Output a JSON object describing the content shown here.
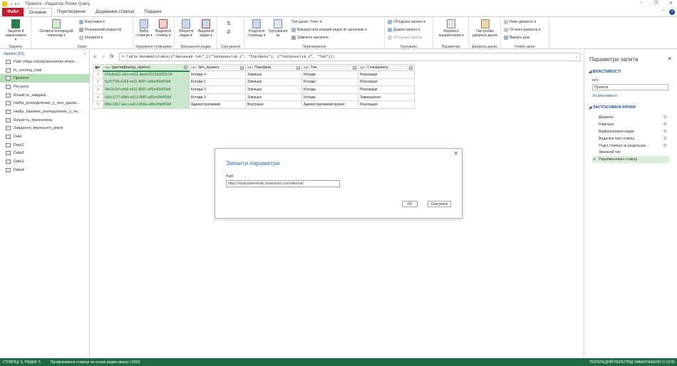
{
  "window": {
    "title": "Проекти - Редактор Power Query",
    "quick_access": "☺ ▾  ≡",
    "min": "–",
    "restore": "❐",
    "close": "✕"
  },
  "tabs": [
    {
      "label": "Файл"
    },
    {
      "label": "Основне"
    },
    {
      "label": "Перетворення"
    },
    {
      "label": "Додавання стовпця"
    },
    {
      "label": "Подання"
    }
  ],
  "ribbon": {
    "close": {
      "label": "Закрити й\nзавантажити ▾",
      "group": "Закрити"
    },
    "query": {
      "refresh": "Оновити попередній\nперегляд ▾",
      "properties": "Властивості",
      "advanced_editor": "Розширений редактор",
      "manage": "Керувати ▾",
      "group": "Запит"
    },
    "columns": {
      "choose": "Вибір\nстовпців ▾",
      "remove": "Видалити\nстовпці ▾",
      "group": "Керування стовпцями"
    },
    "rows": {
      "keep": "Зберегти\nрядки ▾",
      "remove": "Видалити\nрядки ▾",
      "group": "Зменшення рядків"
    },
    "sort": {
      "group": "Сортування"
    },
    "transform": {
      "split": "Розділити\nстовпець ▾",
      "group_by": "Групування\nза",
      "data_type": "Тип даних: Текст ▾",
      "first_row": "Використати перший рядок як заголовки ▾",
      "replace": "Замінити значення",
      "group": "Перетворення"
    },
    "combine": {
      "merge": "Об'єднати запити ▾",
      "append": "Додати запити ▾",
      "files": "Об'єднати файли",
      "group": "Групувати"
    },
    "params": {
      "manage": "Керувати\nпараметрами ▾",
      "group": "Параметри"
    },
    "sources": {
      "settings": "Настройки\nджерела даних",
      "group": "Джерела даних"
    },
    "newquery": {
      "new_source": "Нове джерело ▾",
      "recent": "Останні джерела ▾",
      "enter": "Введіть дані",
      "group": "Новий запит"
    }
  },
  "left_pane": {
    "header": "Запити [16]",
    "collapse": "‹",
    "items": [
      {
        "label": "Path (https://studyoberemoki.share..."
      },
      {
        "label": "fn_running_total"
      },
      {
        "label": "Проекти",
        "selected": true
      },
      {
        "label": "Ресурси"
      },
      {
        "label": "Кількість_завдань"
      },
      {
        "label": "Набір_розподілених_у_часі_даних..."
      },
      {
        "label": "Набір_базових_розподілених_у_ча..."
      },
      {
        "label": "Кількість_призначень"
      },
      {
        "label": "Завдання_верхнього_рівня"
      },
      {
        "label": "Date"
      },
      {
        "label": "Data2"
      },
      {
        "label": "Data3"
      },
      {
        "label": "Data1"
      },
      {
        "label": "Data4"
      }
    ]
  },
  "formula": {
    "cancel": "✕",
    "confirm": "✓",
    "fx": "fx",
    "text": "= Table.RenameColumns(#\"Змінений тип\",{{\"Типпроектів.1\", \"Портфель\"}, {\"Типпроектів.2\", \"Тип\"}})",
    "expand": "⌄"
  },
  "table": {
    "columns": [
      "Ідентифікатор_проекту",
      "Ім'я_проекту",
      "Портфель",
      "Тип",
      "Станпроекту"
    ],
    "rows": [
      [
        "634a6a52-a9cc-ed11-aba9-00155d201c34",
        "Котедж 4",
        "Зовнішні",
        "Котедж",
        "Реалізація"
      ],
      [
        "5c2071fb-e2b5-ed11-8687-a85e45b459df",
        "Котедж 1",
        "Зовнішні",
        "Котедж",
        "Реалізація"
      ],
      [
        "94e2e2cf-e4b5-ed11-8687-a85e45b459df",
        "Котедж 2",
        "Зовнішні",
        "Котедж",
        "Реалізація"
      ],
      [
        "b9cc1177-e5b5-ed11-8687-a85e45b459df",
        "Котедж 3",
        "Зовнішні",
        "Котедж",
        "Завершення"
      ],
      [
        "86bc12b7-aacc-ed11-868a-a85e45b459df",
        "Адміністративний",
        "Внутрішні",
        "Адміністративний проект",
        "Реалізація"
      ]
    ]
  },
  "right_pane": {
    "title": "Параметри запита",
    "close": "✕",
    "properties_header": "◢ ВЛАСТИВОСТІ",
    "name_label": "Ім'я",
    "name_value": "Проекти",
    "all_properties": "Усі властивості",
    "steps_header": "◢ ЗАСТОСОВАНІ КРОКИ",
    "steps": [
      {
        "label": "Джерело",
        "gear": true
      },
      {
        "label": "Навігація",
        "gear": true
      },
      {
        "label": "Відфільтровані рядки",
        "gear": true
      },
      {
        "label": "Видалені інші стовпці",
        "gear": true
      },
      {
        "label": "Поділ стовпця за роздільник...",
        "gear": true
      },
      {
        "label": "Змінений тип",
        "gear": false
      },
      {
        "label": "Перейменовані стовпці",
        "gear": false,
        "active": true
      }
    ]
  },
  "dialog": {
    "title": "Змінити параметри",
    "close": "✕",
    "field_label": "Path",
    "field_value": "https://studyoberemoki.sharepoint.com/sites/ua/",
    "ok": "OK",
    "cancel": "Скасувати"
  },
  "status": {
    "left": "СТОВПЦІ: 5, РЯДКИ: 5",
    "middle": "Профілювання стовпця на основі рядків зверху (1000)",
    "right": "ПОПЕРЕДНІЙ ПЕРЕГЛЯД ЗАВАНТАЖЕНО О 13:05"
  },
  "colors": {
    "accent_green": "#1e6b43",
    "file_tab": "#c9192e",
    "selected": "#b7dfb9"
  }
}
